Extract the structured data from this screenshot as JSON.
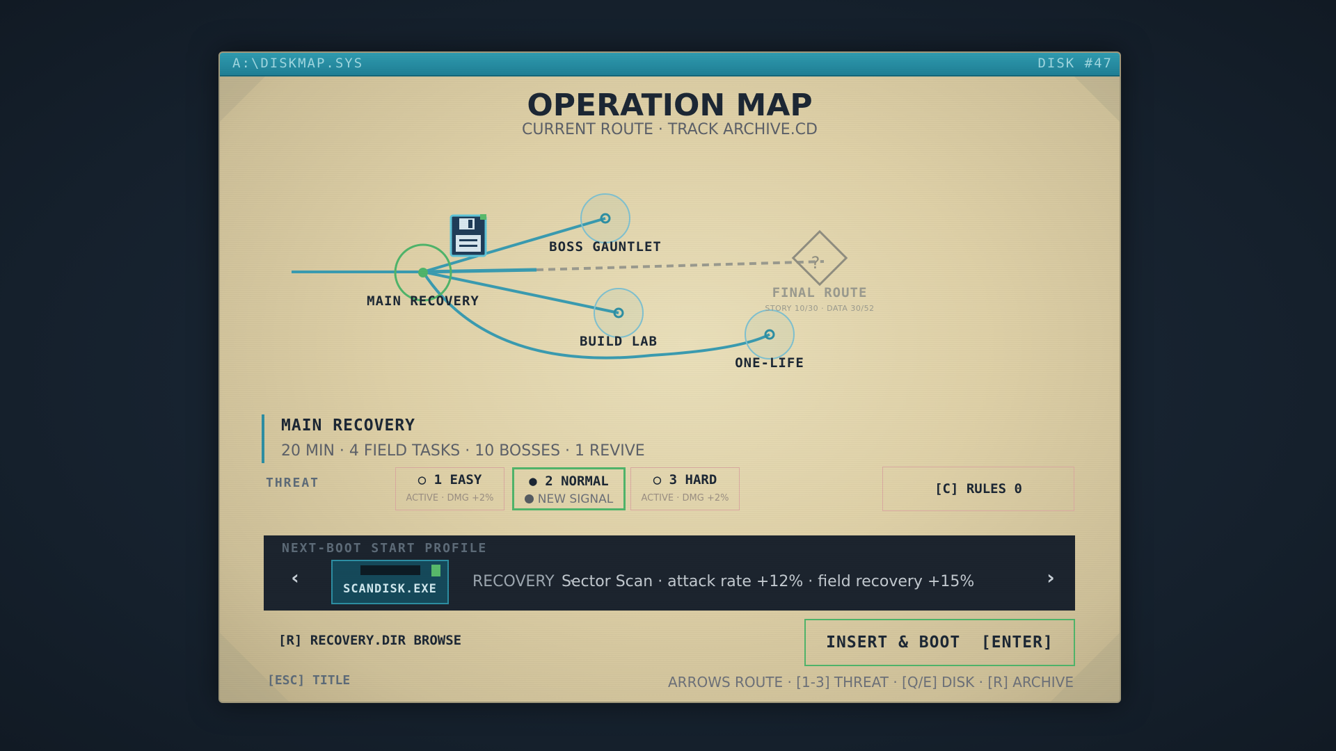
{
  "window": {
    "path": "A:\\DISKMAP.SYS",
    "disk_id": "DISK #47"
  },
  "header": {
    "title": "OPERATION MAP",
    "subtitle": "CURRENT ROUTE · TRACK ARCHIVE.CD"
  },
  "map": {
    "nodes": [
      {
        "id": "main",
        "label": "MAIN RECOVERY",
        "state": "current"
      },
      {
        "id": "boss",
        "label": "BOSS GAUNTLET",
        "state": "available"
      },
      {
        "id": "build",
        "label": "BUILD LAB",
        "state": "available"
      },
      {
        "id": "onelife",
        "label": "ONE-LIFE",
        "state": "available"
      },
      {
        "id": "final",
        "label": "FINAL ROUTE",
        "state": "locked",
        "locked_glyph": "?",
        "requirement": "STORY 10/30 · DATA 30/52"
      }
    ],
    "current_icon": "floppy-disk-icon"
  },
  "selection": {
    "name": "MAIN RECOVERY",
    "info": "20 MIN · 4 FIELD TASKS · 10 BOSSES · 1 REVIVE"
  },
  "threat": {
    "label": "THREAT",
    "options": [
      {
        "bullet": "○",
        "label": "1 EASY",
        "sub": "ACTIVE · DMG +2%",
        "selected": false
      },
      {
        "bullet": "●",
        "label": "2 NORMAL",
        "sub": "NEW SIGNAL",
        "selected": true
      },
      {
        "bullet": "○",
        "label": "3 HARD",
        "sub": "ACTIVE · DMG +2%",
        "selected": false
      }
    ]
  },
  "rules": {
    "label": "[C] RULES 0"
  },
  "profile": {
    "title": "NEXT-BOOT START PROFILE",
    "prev_glyph": "‹",
    "next_glyph": "›",
    "disk_name": "SCANDISK.EXE",
    "type": "RECOVERY",
    "separator": "·",
    "description": "Sector Scan · attack rate +12% · field recovery +15%"
  },
  "footer": {
    "browse": "[R] RECOVERY.DIR BROWSE",
    "boot": "INSERT & BOOT  [ENTER]",
    "esc": "[ESC] TITLE",
    "help": "ARROWS ROUTE · [1-3] THREAT · [Q/E] DISK · [R] ARCHIVE"
  },
  "colors": {
    "accent": "#2d8ea3",
    "route": "#3a9bb0",
    "current": "#4fb46a",
    "panel": "#e4d9b2",
    "ink": "#1c2734",
    "dark": "#1c242e"
  }
}
